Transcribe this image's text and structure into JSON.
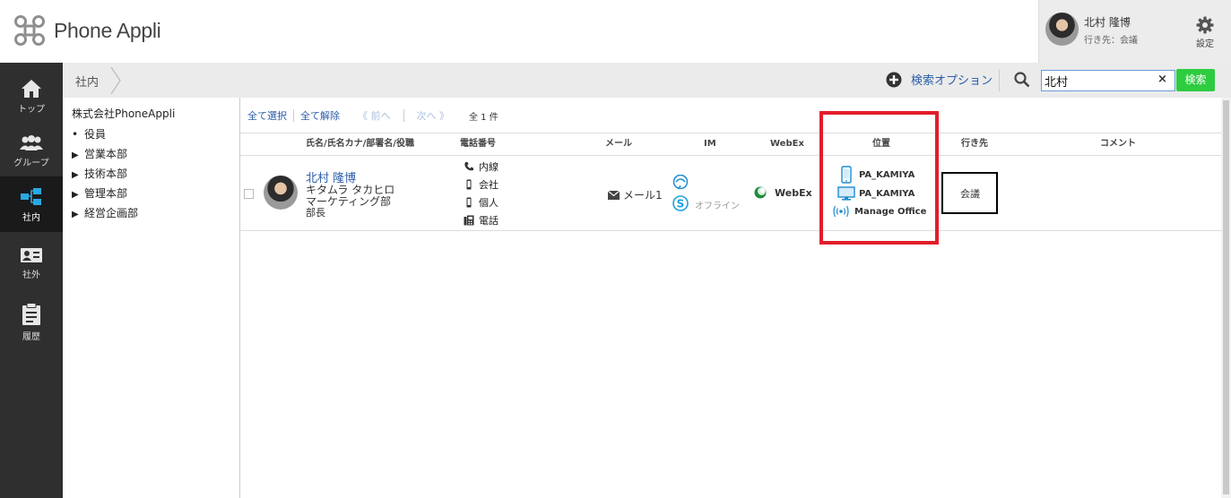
{
  "app": {
    "name": "Phone Appli"
  },
  "user": {
    "name": "北村 隆博",
    "status": "行き先：会議"
  },
  "header": {
    "settings_label": "設定"
  },
  "sidebar": {
    "items": [
      {
        "label": "トップ",
        "icon": "home-icon"
      },
      {
        "label": "グループ",
        "icon": "group-icon"
      },
      {
        "label": "社内",
        "icon": "org-chart-icon",
        "active": true
      },
      {
        "label": "社外",
        "icon": "contact-card-icon"
      },
      {
        "label": "履歴",
        "icon": "clipboard-icon"
      }
    ]
  },
  "breadcrumb": {
    "current": "社内"
  },
  "search": {
    "advanced_label": "検索オプション",
    "value": "北村",
    "button_label": "検索",
    "clear_symbol": "×"
  },
  "tree": {
    "root": "株式会社PhoneAppli",
    "items": [
      {
        "marker": "•",
        "label": "役員"
      },
      {
        "marker": "▶",
        "label": "営業本部"
      },
      {
        "marker": "▶",
        "label": "技術本部"
      },
      {
        "marker": "▶",
        "label": "管理本部"
      },
      {
        "marker": "▶",
        "label": "経営企画部"
      }
    ]
  },
  "toolbar": {
    "select_all": "全て選択",
    "deselect_all": "全て解除",
    "prev": "《 前へ",
    "next": "次へ 》",
    "count": "全 1 件"
  },
  "columns": {
    "name": "氏名/氏名カナ/部署名/役職",
    "phone": "電話番号",
    "mail": "メール",
    "im": "IM",
    "webex": "WebEx",
    "location": "位置",
    "destination": "行き先",
    "comment": "コメント"
  },
  "row": {
    "name": "北村 隆博",
    "kana": "キタムラ タカヒロ",
    "department": "マーケティング部",
    "title": "部長",
    "phones": [
      {
        "icon": "phone-icon",
        "label": "内線"
      },
      {
        "icon": "mobile-icon",
        "label": "会社"
      },
      {
        "icon": "mobile-icon",
        "label": "個人"
      },
      {
        "icon": "fax-icon",
        "label": "電話"
      }
    ],
    "mail_label": "メール1",
    "im_status": "オフライン",
    "webex_label": "WebEx",
    "locations": [
      "PA_KAMIYA",
      "PA_KAMIYA",
      "Manage Office"
    ],
    "destination": "会議",
    "comment": ""
  },
  "colors": {
    "accent_green": "#2ecc40",
    "link_blue": "#2a5ca8",
    "highlight_red": "#e21d2a",
    "sidebar_bg": "#2f2f2f"
  }
}
